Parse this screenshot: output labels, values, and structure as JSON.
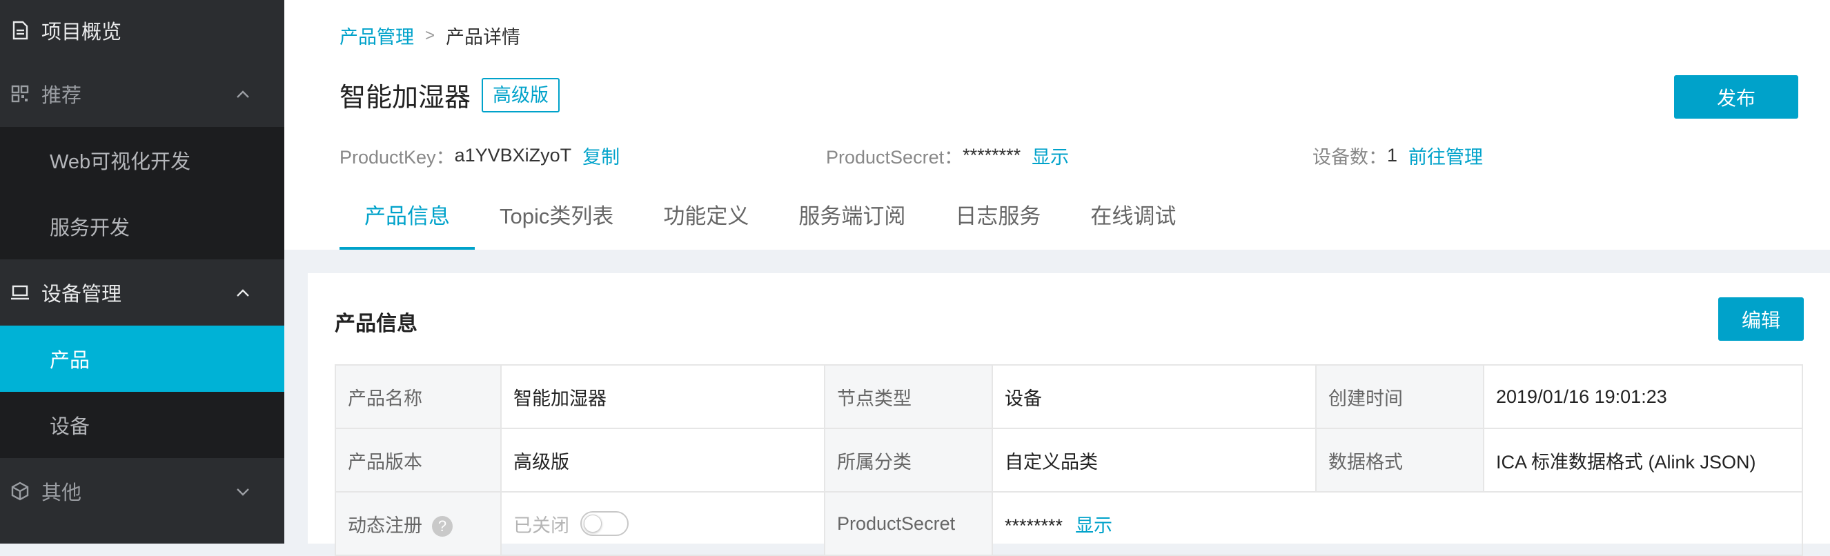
{
  "sidebar": {
    "items": [
      {
        "label": "项目概览",
        "icon": "document-icon"
      },
      {
        "label": "推荐",
        "icon": "grid-icon",
        "expanded": true
      },
      {
        "label": "Web可视化开发"
      },
      {
        "label": "服务开发"
      },
      {
        "label": "设备管理",
        "icon": "laptop-icon",
        "expanded": true
      },
      {
        "label": "产品",
        "active": true
      },
      {
        "label": "设备"
      },
      {
        "label": "其他",
        "icon": "cube-icon",
        "expanded": false
      }
    ]
  },
  "breadcrumb": {
    "parent": "产品管理",
    "separator": ">",
    "current": "产品详情"
  },
  "header": {
    "title": "智能加湿器",
    "badge": "高级版",
    "publish_label": "发布",
    "product_key_label": "ProductKey：",
    "product_key_value": "a1YVBXiZyoT",
    "copy_label": "复制",
    "product_secret_label": "ProductSecret：",
    "product_secret_value": "********",
    "show_label": "显示",
    "device_count_label": "设备数：",
    "device_count_value": "1",
    "manage_label": "前往管理"
  },
  "tabs": [
    {
      "label": "产品信息",
      "active": true
    },
    {
      "label": "Topic类列表"
    },
    {
      "label": "功能定义"
    },
    {
      "label": "服务端订阅"
    },
    {
      "label": "日志服务"
    },
    {
      "label": "在线调试"
    }
  ],
  "card": {
    "title": "产品信息",
    "edit_label": "编辑",
    "rows": [
      [
        {
          "label": "产品名称",
          "value": "智能加湿器"
        },
        {
          "label": "节点类型",
          "value": "设备"
        },
        {
          "label": "创建时间",
          "value": "2019/01/16 19:01:23"
        }
      ],
      [
        {
          "label": "产品版本",
          "value": "高级版"
        },
        {
          "label": "所属分类",
          "value": "自定义品类"
        },
        {
          "label": "数据格式",
          "value": "ICA 标准数据格式 (Alink JSON)"
        }
      ]
    ],
    "row3": {
      "dynamic_label": "动态注册",
      "help": "?",
      "switch_state": "已关闭",
      "secret_label": "ProductSecret",
      "secret_value": "********",
      "secret_show": "显示"
    }
  },
  "colors": {
    "accent": "#00a2ca",
    "sidebar_bg": "#2b2d30",
    "sidebar_child_bg": "#1c1d1f",
    "sidebar_active_bg": "#00b2d6"
  }
}
